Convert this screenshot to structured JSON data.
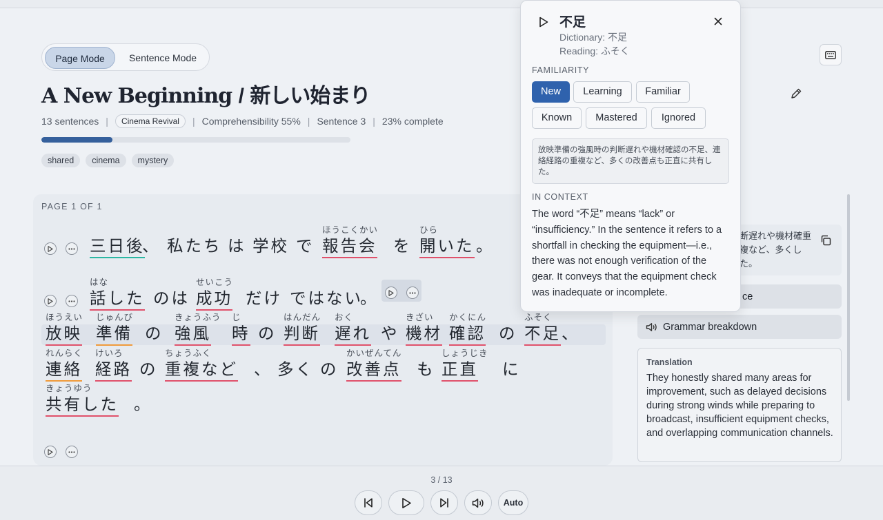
{
  "modes": {
    "page": "Page Mode",
    "sentence": "Sentence Mode"
  },
  "title": {
    "en": "A New Beginning",
    "sep": "/",
    "jp": "新しい始まり"
  },
  "meta": {
    "sentences": "13 sentences",
    "collection": "Cinema Revival",
    "comprehensibility": "Comprehensibility 55%",
    "sentence": "Sentence 3",
    "complete": "23% complete",
    "progress_percent": 23
  },
  "tags": [
    "shared",
    "cinema",
    "mystery"
  ],
  "reader": {
    "page_label": "PAGE 1 OF 1",
    "words": [
      {
        "base": "三日後",
        "ruby": ""
      },
      {
        "base": "、",
        "ruby": ""
      },
      {
        "base": "私たち",
        "ruby": ""
      },
      {
        "base": "は",
        "ruby": ""
      },
      {
        "base": "学校",
        "ruby": ""
      },
      {
        "base": "で",
        "ruby": ""
      },
      {
        "base": "報告会",
        "ruby": "ほうこくかい"
      },
      {
        "base": "を",
        "ruby": ""
      },
      {
        "base": "開いた",
        "ruby": "ひら"
      },
      {
        "base": "。",
        "ruby": ""
      },
      {
        "base": "話した",
        "ruby": "はな"
      },
      {
        "base": "のは",
        "ruby": ""
      },
      {
        "base": "成功",
        "ruby": "せいこう"
      },
      {
        "base": "だけ",
        "ruby": ""
      },
      {
        "base": "ではない",
        "ruby": ""
      },
      {
        "base": "。",
        "ruby": ""
      },
      {
        "base": "放映",
        "ruby": "ほうえい"
      },
      {
        "base": "準備",
        "ruby": "じゅんび"
      },
      {
        "base": "の",
        "ruby": ""
      },
      {
        "base": "強風",
        "ruby": "きょうふう"
      },
      {
        "base": "時",
        "ruby": "じ"
      },
      {
        "base": "の",
        "ruby": ""
      },
      {
        "base": "判断",
        "ruby": "はんだん"
      },
      {
        "base": "遅れ",
        "ruby": "おく"
      },
      {
        "base": "や",
        "ruby": ""
      },
      {
        "base": "機材",
        "ruby": "きざい"
      },
      {
        "base": "確認",
        "ruby": "かくにん"
      },
      {
        "base": "の",
        "ruby": ""
      },
      {
        "base": "不足",
        "ruby": "ふそく"
      },
      {
        "base": "、",
        "ruby": ""
      },
      {
        "base": "連絡",
        "ruby": "れんらく"
      },
      {
        "base": "経路",
        "ruby": "けいろ"
      },
      {
        "base": "の",
        "ruby": ""
      },
      {
        "base": "重複など",
        "ruby": "ちょうふく"
      },
      {
        "base": "、",
        "ruby": ""
      },
      {
        "base": "多く",
        "ruby": ""
      },
      {
        "base": "の",
        "ruby": ""
      },
      {
        "base": "改善点",
        "ruby": "かいぜんてん"
      },
      {
        "base": "も",
        "ruby": ""
      },
      {
        "base": "正直",
        "ruby": "しょうじき"
      },
      {
        "base": "に",
        "ruby": ""
      },
      {
        "base": "共有した",
        "ruby": "きょうゆう"
      },
      {
        "base": "。",
        "ruby": ""
      }
    ]
  },
  "popup": {
    "word": "不足",
    "dictionary": "Dictionary: 不足",
    "reading": "Reading: ふそく",
    "familiarity_label": "FAMILIARITY",
    "familiarity_options": [
      "New",
      "Learning",
      "Familiar",
      "Known",
      "Mastered",
      "Ignored"
    ],
    "familiarity_selected": "New",
    "sentence": "放映準備の強風時の判断遅れや機材確認の不足、連絡経路の重複など、多くの改善点も正直に共有した。",
    "context_label": "IN CONTEXT",
    "context": "The word “不足” means “lack” or “insufficiency.” In the sentence it refers to a shortfall in checking the equipment—i.e., there was not enough verification of the gear. It conveys that the equipment check was inadequate or incomplete."
  },
  "side": {
    "sentence_snippet": "断遅れや機材確重複など、多くした。",
    "button1": "ce",
    "grammar": "Grammar breakdown",
    "translation_label": "Translation",
    "translation": "They honestly shared many areas for improvement, such as delayed decisions during strong winds while preparing to broadcast, insufficient equipment checks, and overlapping communication channels."
  },
  "bottom": {
    "counter": "3 / 13",
    "auto": "Auto"
  },
  "colors": {
    "accent": "#2f62ad",
    "underline_new": "#e0506a",
    "underline_known": "#2bb7a3",
    "underline_learning": "#f09a3a"
  },
  "icons": [
    "keyboard-icon",
    "pencil-icon",
    "play-icon",
    "more-icon",
    "close-icon",
    "copy-icon",
    "speaker-icon",
    "skip-back-icon",
    "skip-forward-icon"
  ]
}
